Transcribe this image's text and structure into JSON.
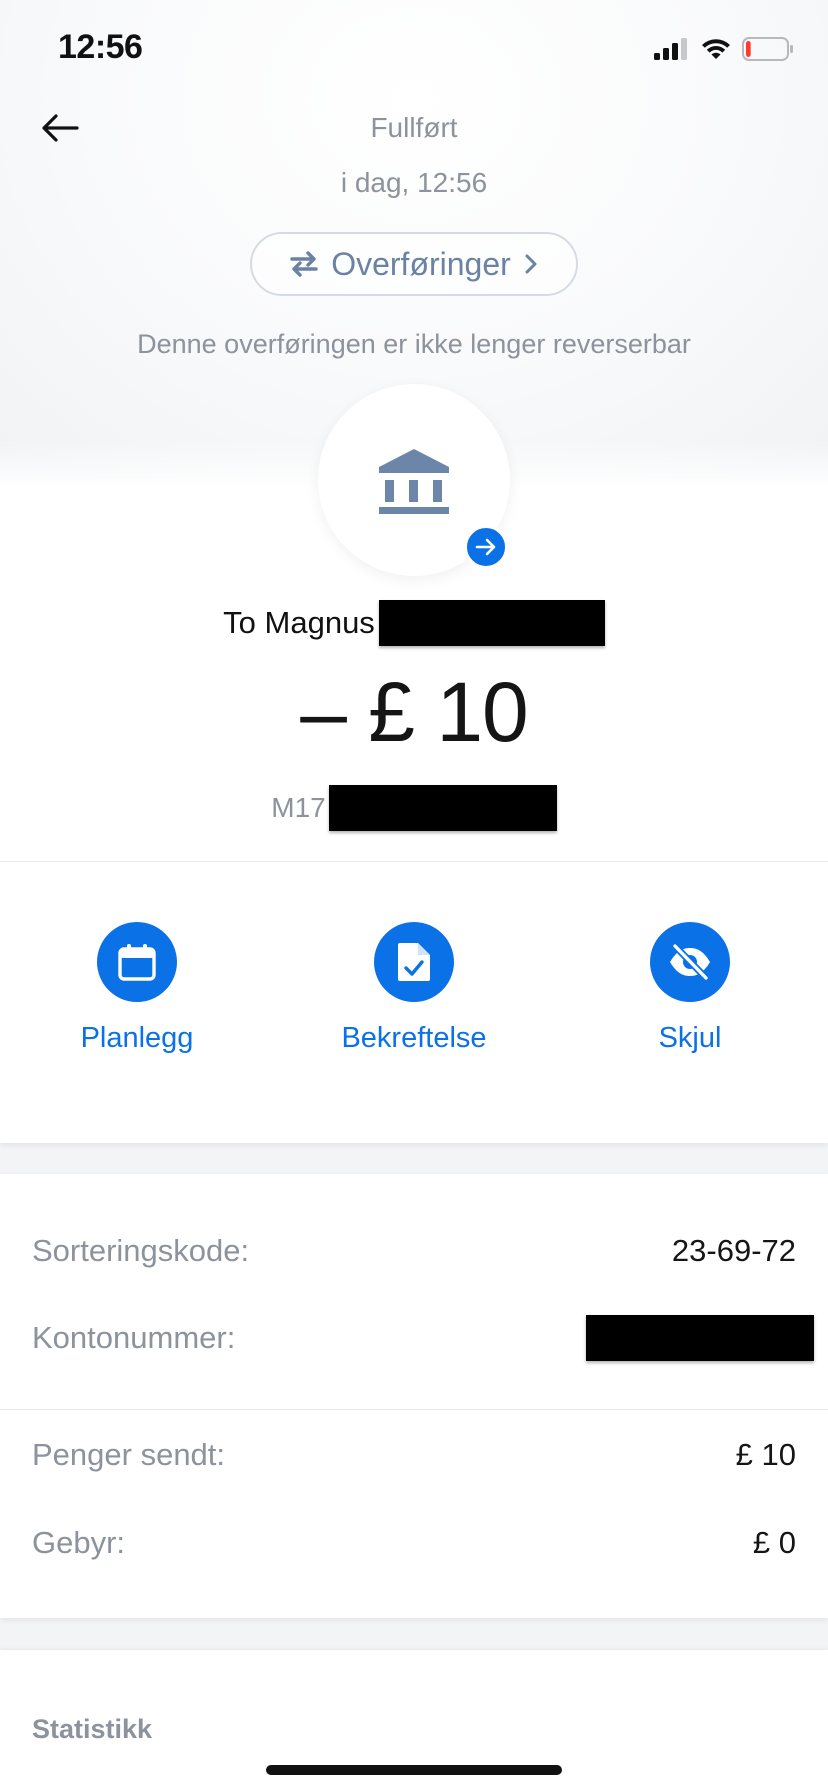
{
  "status_bar": {
    "time": "12:56",
    "battery_level": 0.12,
    "battery_color": "#ff3b30"
  },
  "header": {
    "back_icon": "arrow-left-icon",
    "status": "Fullført",
    "date": "i dag, 12:56",
    "category": {
      "label": "Overføringer",
      "icon": "swap-arrows-icon",
      "chevron": "chevron-right-icon"
    },
    "note": "Denne overføringen er ikke lenger reverserbar"
  },
  "transaction": {
    "avatar_icon": "bank-icon",
    "badge_icon": "arrow-right-icon",
    "recipient_prefix": "To Magnus",
    "amount": "– £ 10",
    "reference_prefix": "M17"
  },
  "actions": [
    {
      "label": "Planlegg",
      "icon": "calendar-icon"
    },
    {
      "label": "Bekreftelse",
      "icon": "document-check-icon"
    },
    {
      "label": "Skjul",
      "icon": "eye-off-icon"
    }
  ],
  "details": {
    "sort_code_label": "Sorteringskode:",
    "sort_code_value": "23-69-72",
    "account_label": "Kontonummer:",
    "money_sent_label": "Penger sendt:",
    "money_sent_value": "£ 10",
    "fee_label": "Gebyr:",
    "fee_value": "£ 0"
  },
  "stats": {
    "title": "Statistikk"
  },
  "colors": {
    "accent": "#0a72e6",
    "muted_text": "#8c939c",
    "pill_text": "#6b82a3",
    "bank_icon": "#6b86a8"
  }
}
